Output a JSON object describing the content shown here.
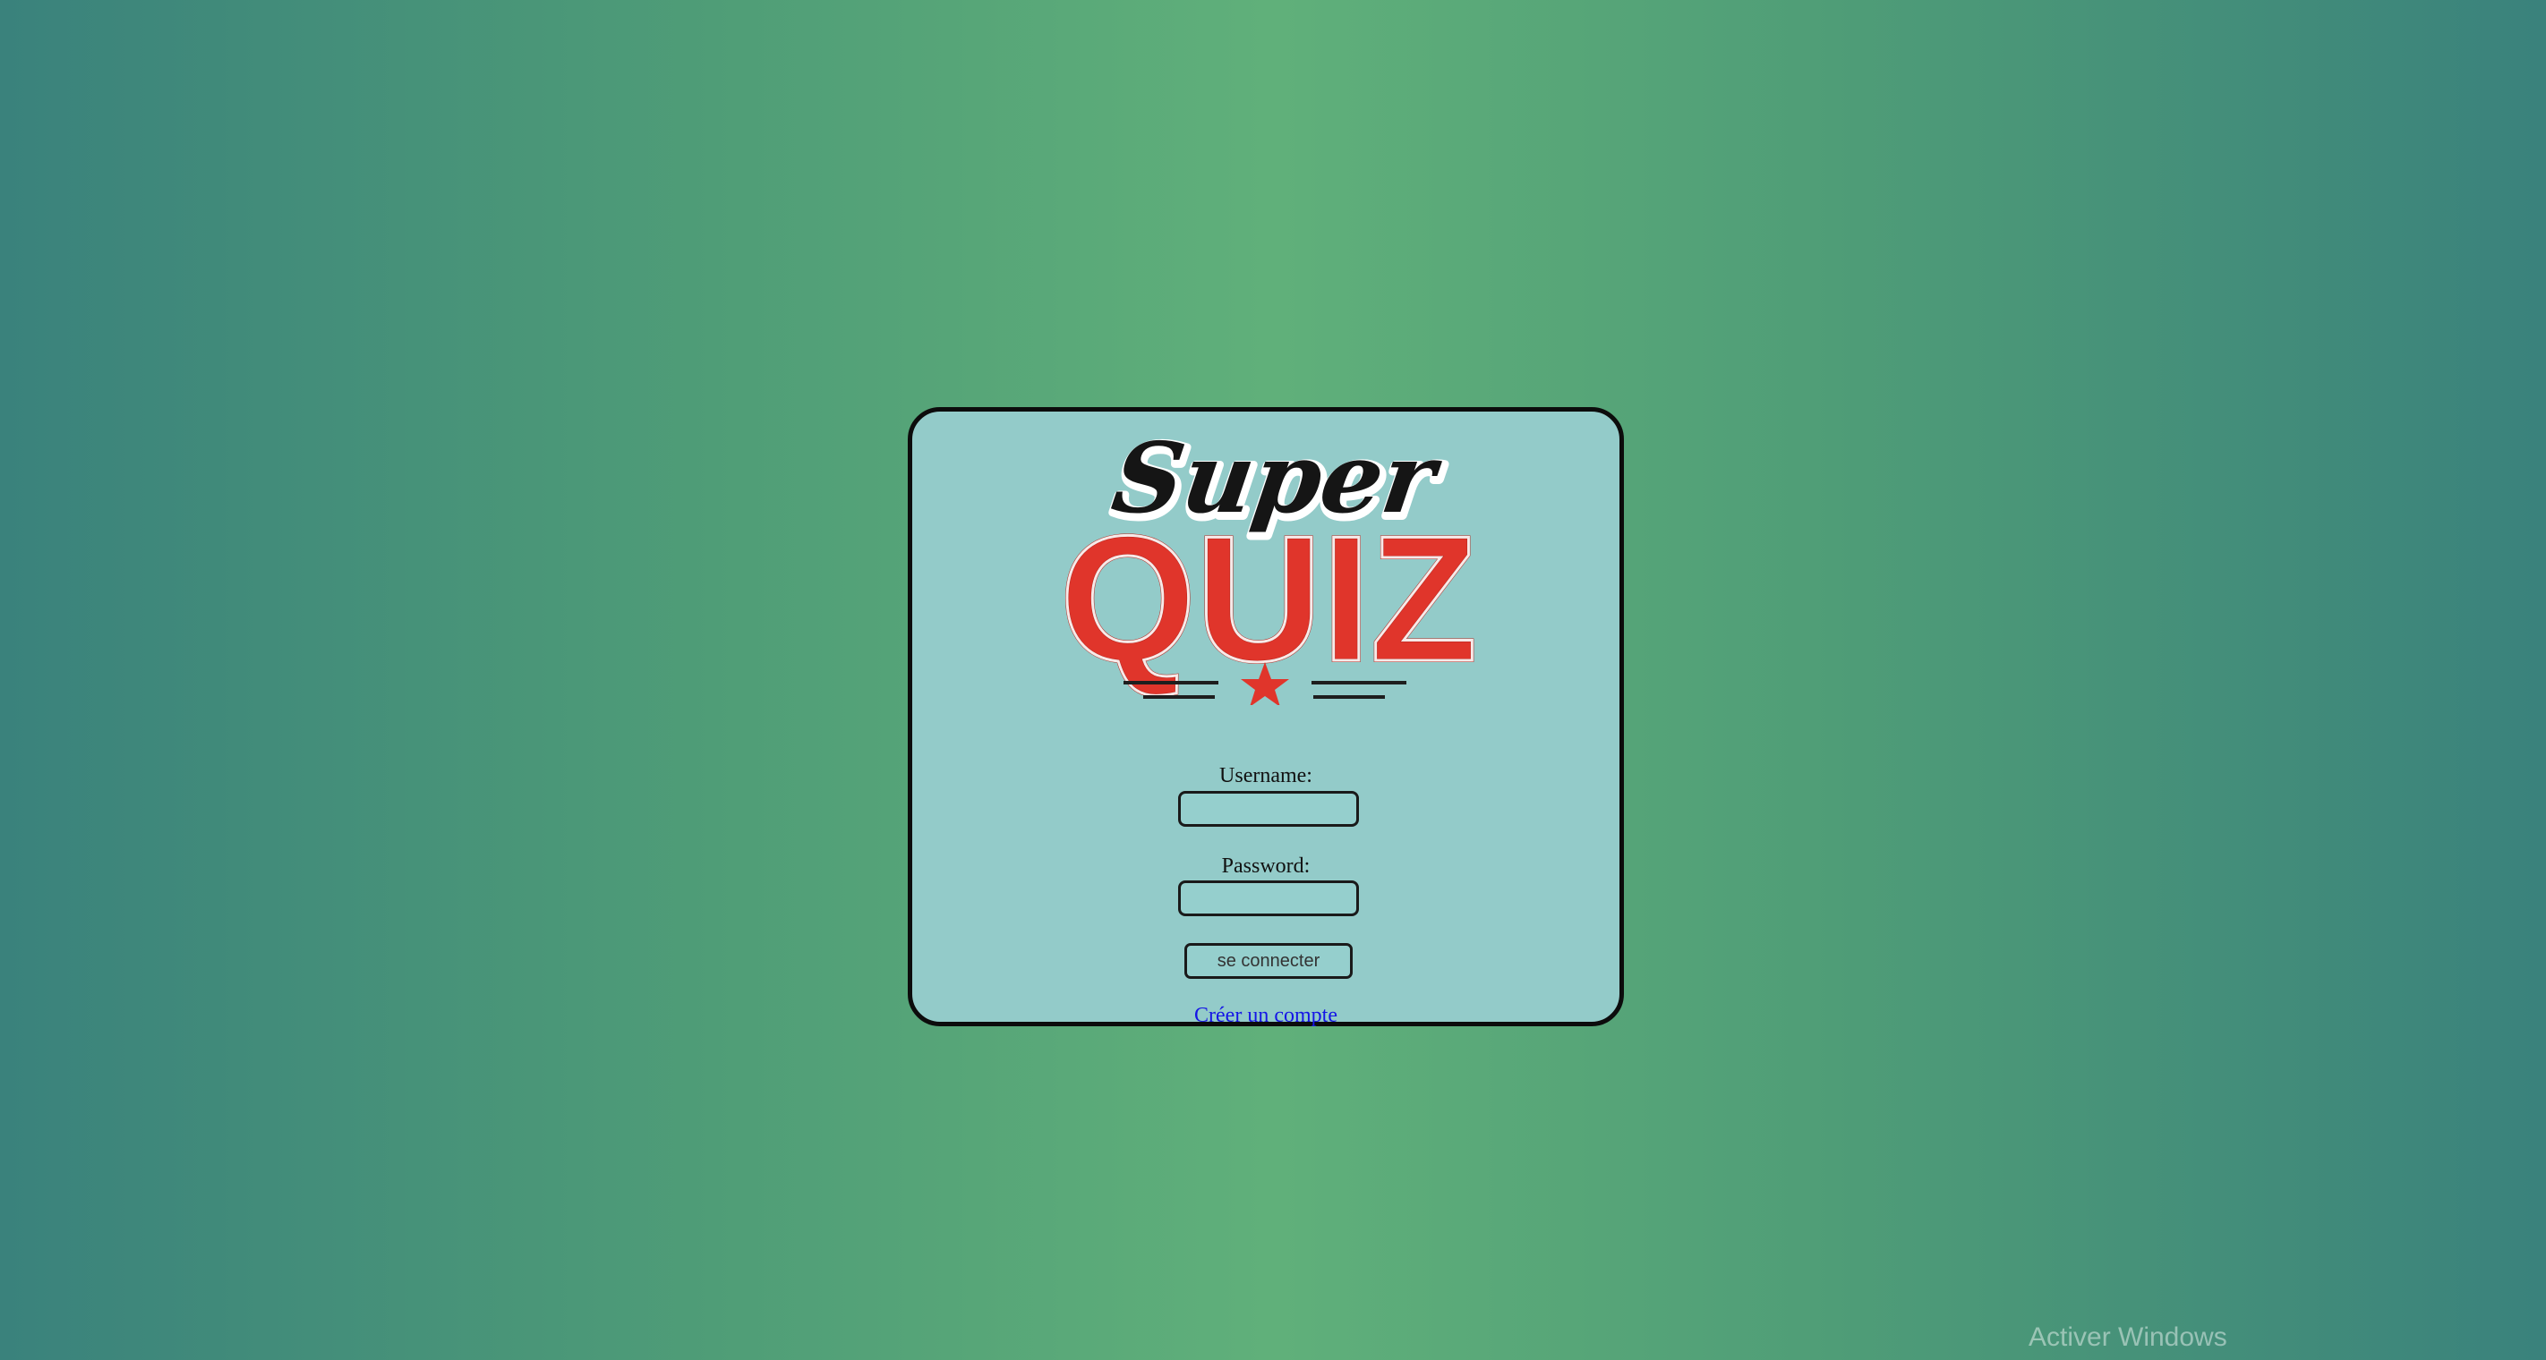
{
  "logo": {
    "line1": "Super",
    "line2": "QUIZ",
    "accent_color": "#e0352b",
    "script_color": "#151515"
  },
  "form": {
    "username_label": "Username:",
    "username_value": "",
    "password_label": "Password:",
    "password_value": "",
    "submit_label": "se connecter",
    "create_account_link": "Créer un compte"
  },
  "watermark": "Activer Windows"
}
